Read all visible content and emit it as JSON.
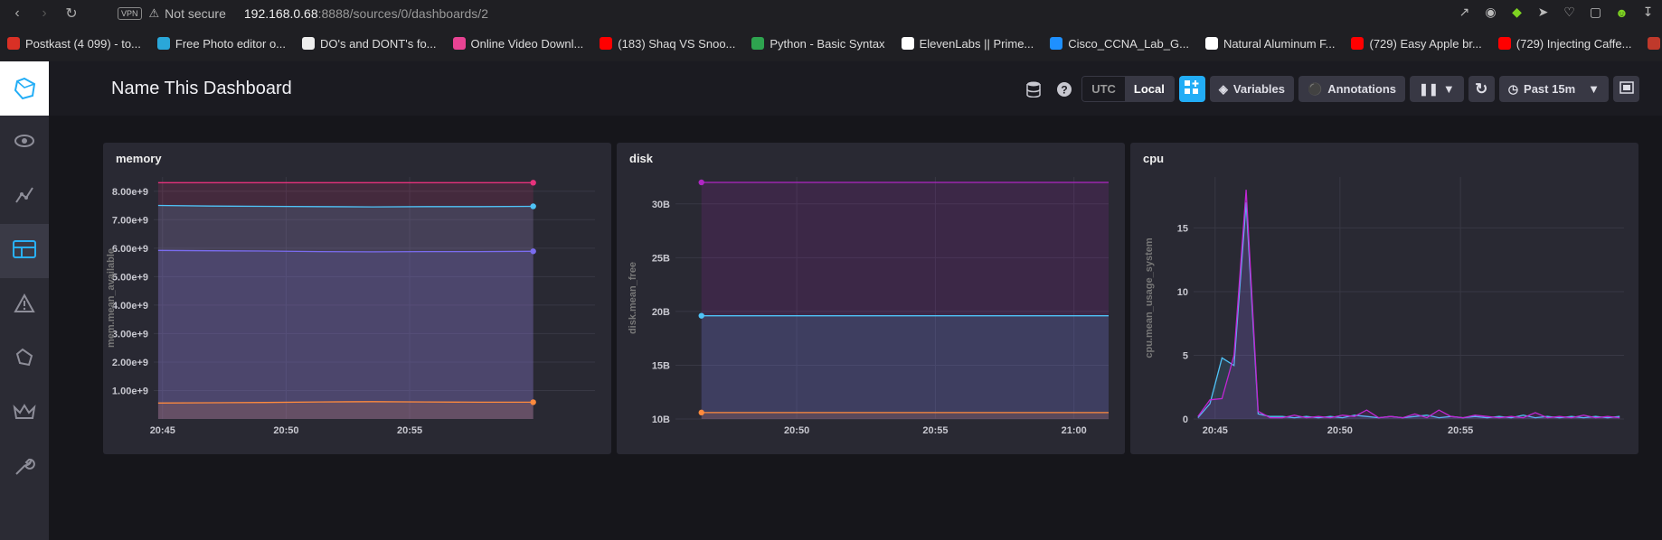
{
  "browser": {
    "vpn": "VPN",
    "security_label": "Not secure",
    "url_host": "192.168.0.68",
    "url_path": ":8888/sources/0/dashboards/2",
    "bookmarks": [
      {
        "label": "Postkast (4 099) - to...",
        "color": "#d93025"
      },
      {
        "label": "Free Photo editor o...",
        "color": "#2aa7d9"
      },
      {
        "label": "DO's and DONT's fo...",
        "color": "#eeeeee"
      },
      {
        "label": "Online Video Downl...",
        "color": "#e84393"
      },
      {
        "label": "(183) Shaq VS Snoo...",
        "color": "#ff0000"
      },
      {
        "label": "Python - Basic Syntax",
        "color": "#2ea44f"
      },
      {
        "label": "ElevenLabs || Prime...",
        "color": "#ffffff"
      },
      {
        "label": "Cisco_CCNA_Lab_G...",
        "color": "#1e90ff"
      },
      {
        "label": "Natural Aluminum F...",
        "color": "#ffffff"
      },
      {
        "label": "(729) Easy Apple br...",
        "color": "#ff0000"
      },
      {
        "label": "(729) Injecting Caffe...",
        "color": "#ff0000"
      },
      {
        "label": "Homebrew Walkthr...",
        "color": "#c0392b"
      }
    ]
  },
  "header": {
    "title": "Name This Dashboard",
    "tz_utc": "UTC",
    "tz_local": "Local",
    "variables": "Variables",
    "annotations": "Annotations",
    "time_range": "Past 15m"
  },
  "cells": [
    {
      "title": "memory",
      "ylabel": "mem.mean_available"
    },
    {
      "title": "disk",
      "ylabel": "disk.mean_free"
    },
    {
      "title": "cpu",
      "ylabel": "cpu.mean_usage_system"
    }
  ],
  "chart_data": [
    {
      "type": "area",
      "title": "memory",
      "ylabel": "mem.mean_available",
      "x_ticks": [
        "20:45",
        "20:50",
        "20:55"
      ],
      "y_ticks": [
        "1.00e+9",
        "2.00e+9",
        "3.00e+9",
        "4.00e+9",
        "5.00e+9",
        "6.00e+9",
        "7.00e+9",
        "8.00e+9"
      ],
      "ylim": [
        0,
        8500000000
      ],
      "series": [
        {
          "color": "#e8327c",
          "values": [
            8300000000,
            8300000000,
            8300000000,
            8300000000,
            8300000000,
            8300000000,
            8300000000,
            8300000000
          ]
        },
        {
          "color": "#4fc3f7",
          "values": [
            7500000000,
            7480000000,
            7470000000,
            7460000000,
            7450000000,
            7460000000,
            7460000000,
            7470000000
          ]
        },
        {
          "color": "#7a6cf0",
          "values": [
            5920000000,
            5910000000,
            5900000000,
            5880000000,
            5870000000,
            5880000000,
            5880000000,
            5890000000
          ]
        },
        {
          "color": "#ff8a3d",
          "values": [
            560000000,
            570000000,
            580000000,
            600000000,
            610000000,
            600000000,
            590000000,
            590000000
          ]
        }
      ]
    },
    {
      "type": "area",
      "title": "disk",
      "ylabel": "disk.mean_free",
      "x_ticks": [
        "20:50",
        "20:55",
        "21:00"
      ],
      "y_ticks": [
        "10B",
        "15B",
        "20B",
        "25B",
        "30B"
      ],
      "ylim": [
        10,
        32.5
      ],
      "series": [
        {
          "color": "#b026c4",
          "values": [
            32,
            32,
            32,
            32,
            32,
            32,
            32
          ]
        },
        {
          "color": "#4fc3f7",
          "values": [
            19.6,
            19.6,
            19.6,
            19.6,
            19.6,
            19.6,
            19.6
          ]
        },
        {
          "color": "#ff8a3d",
          "values": [
            10.6,
            10.6,
            10.6,
            10.6,
            10.6,
            10.6,
            10.6
          ]
        }
      ]
    },
    {
      "type": "line",
      "title": "cpu",
      "ylabel": "cpu.mean_usage_system",
      "x_ticks": [
        "20:45",
        "20:50",
        "20:55"
      ],
      "y_ticks": [
        "0",
        "5",
        "10",
        "15"
      ],
      "ylim": [
        0,
        19
      ],
      "series": [
        {
          "color": "#4fc3f7",
          "values": [
            0.1,
            1.2,
            4.8,
            4.2,
            17.0,
            0.4,
            0.2,
            0.2,
            0.1,
            0.2,
            0.1,
            0.2,
            0.1,
            0.3,
            0.2,
            0.1,
            0.2,
            0.1,
            0.2,
            0.3,
            0.1,
            0.2,
            0.1,
            0.2,
            0.1,
            0.2,
            0.1,
            0.3,
            0.1,
            0.2,
            0.1,
            0.2,
            0.1,
            0.2,
            0.1,
            0.2
          ]
        },
        {
          "color": "#c026d3",
          "values": [
            0.2,
            1.5,
            1.6,
            5.0,
            18.0,
            0.6,
            0.1,
            0.1,
            0.3,
            0.1,
            0.2,
            0.1,
            0.3,
            0.2,
            0.7,
            0.1,
            0.2,
            0.1,
            0.4,
            0.1,
            0.7,
            0.2,
            0.1,
            0.3,
            0.2,
            0.1,
            0.2,
            0.1,
            0.5,
            0.1,
            0.2,
            0.1,
            0.3,
            0.1,
            0.2,
            0.1
          ]
        }
      ]
    }
  ]
}
